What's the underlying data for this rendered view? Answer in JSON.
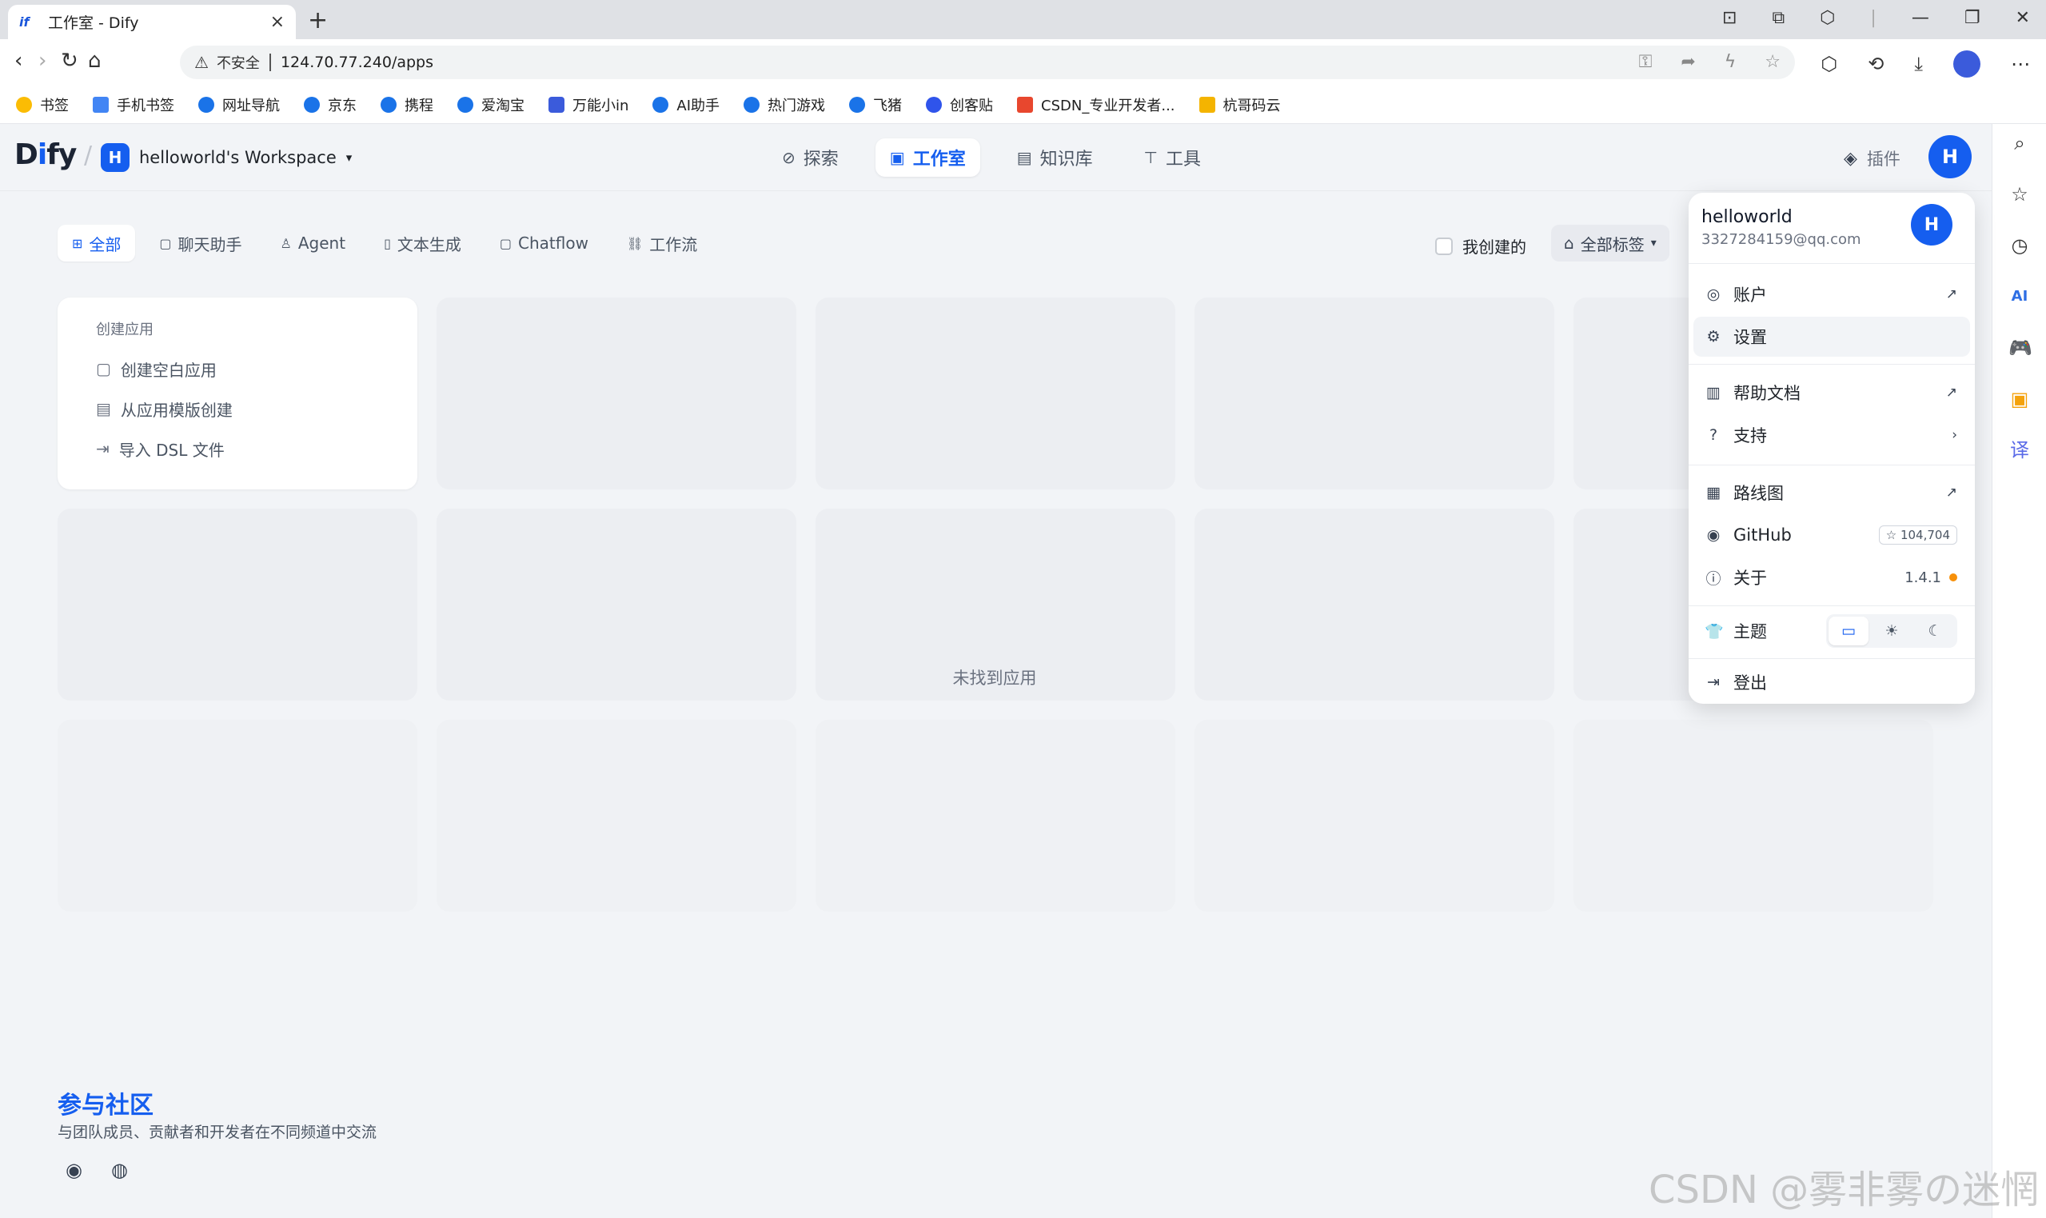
{
  "browser": {
    "tab_icon": "if",
    "tab_title": "工作室 - Dify",
    "tab_close": "×",
    "new_tab": "+",
    "insecure": "不安全",
    "url": "124.70.77.240/apps"
  },
  "bookmarks": [
    {
      "label": "书签",
      "color": "#fbbc04"
    },
    {
      "label": "手机书签",
      "color": "#4285f4"
    },
    {
      "label": "网址导航",
      "color": "#1a73e8"
    },
    {
      "label": "京东",
      "color": "#1a73e8"
    },
    {
      "label": "携程",
      "color": "#1a73e8"
    },
    {
      "label": "爱淘宝",
      "color": "#1a73e8"
    },
    {
      "label": "万能小in",
      "color": "#3b5bdb"
    },
    {
      "label": "AI助手",
      "color": "#1a73e8"
    },
    {
      "label": "热门游戏",
      "color": "#1a73e8"
    },
    {
      "label": "飞猪",
      "color": "#1a73e8"
    },
    {
      "label": "创客贴",
      "color": "#2f54eb"
    },
    {
      "label": "CSDN_专业开发者...",
      "color": "#e8472e"
    },
    {
      "label": "杭哥码云",
      "color": "#f4b400"
    }
  ],
  "app": {
    "logo_d": "D",
    "logo_i": "i",
    "logo_fy": "fy",
    "workspace_badge": "H",
    "workspace_name": "helloworld's Workspace",
    "nav": {
      "explore": "探索",
      "studio": "工作室",
      "knowledge": "知识库",
      "tools": "工具"
    },
    "plugins": "插件",
    "avatar": "H"
  },
  "filters": {
    "all": "全部",
    "chat": "聊天助手",
    "agent": "Agent",
    "text": "文本生成",
    "chatflow": "Chatflow",
    "workflow": "工作流",
    "mine": "我创建的",
    "tags": "全部标签"
  },
  "create": {
    "caption": "创建应用",
    "blank": "创建空白应用",
    "template": "从应用模版创建",
    "dsl": "导入 DSL 文件"
  },
  "empty_text": "未找到应用",
  "community": {
    "title": "参与社区",
    "subtitle": "与团队成员、贡献者和开发者在不同频道中交流"
  },
  "menu": {
    "username": "helloworld",
    "email": "3327284159@qq.com",
    "avatar": "H",
    "account": "账户",
    "settings": "设置",
    "help_docs": "帮助文档",
    "support": "支持",
    "roadmap": "路线图",
    "github": "GitHub",
    "github_stars": "104,704",
    "about": "关于",
    "version": "1.4.1",
    "theme": "主题",
    "logout": "登出"
  },
  "watermark": "CSDN @雾非雾の迷惘",
  "colors": {
    "accent": "#155eef",
    "background": "#f2f4f7",
    "version_dot": "#f79009"
  }
}
